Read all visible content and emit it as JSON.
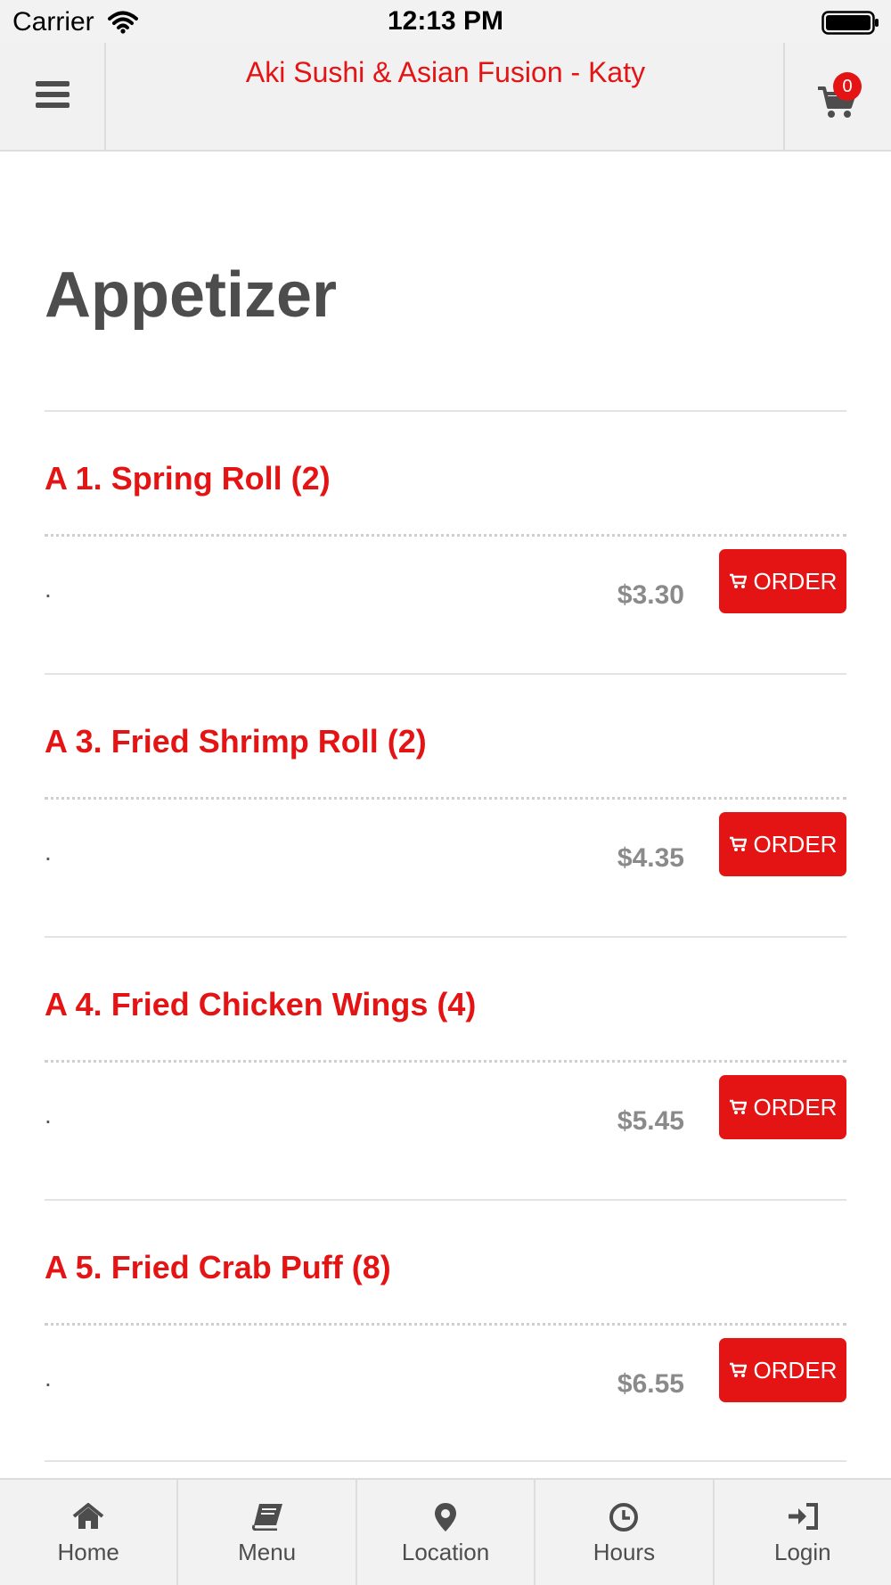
{
  "status_bar": {
    "carrier": "Carrier",
    "time": "12:13 PM"
  },
  "header": {
    "title": "Aki Sushi & Asian Fusion - Katy",
    "cart_count": "0"
  },
  "section": {
    "title": "Appetizer"
  },
  "items": [
    {
      "name": "A 1. Spring Roll (2)",
      "description": ".",
      "price": "$3.30",
      "order_label": "ORDER"
    },
    {
      "name": "A 3. Fried Shrimp Roll (2)",
      "description": ".",
      "price": "$4.35",
      "order_label": "ORDER"
    },
    {
      "name": "A 4. Fried Chicken Wings (4)",
      "description": ".",
      "price": "$5.45",
      "order_label": "ORDER"
    },
    {
      "name": "A 5. Fried Crab Puff (8)",
      "description": ".",
      "price": "$6.55",
      "order_label": "ORDER"
    }
  ],
  "tabs": [
    {
      "label": "Home",
      "icon": "home-icon"
    },
    {
      "label": "Menu",
      "icon": "book-icon"
    },
    {
      "label": "Location",
      "icon": "map-pin-icon"
    },
    {
      "label": "Hours",
      "icon": "clock-icon"
    },
    {
      "label": "Login",
      "icon": "sign-in-icon"
    }
  ],
  "colors": {
    "brand_red": "#e41414",
    "title_gray": "#4d4d4d",
    "price_gray": "#8a8a8a",
    "bar_bg": "#f2f2f2"
  }
}
